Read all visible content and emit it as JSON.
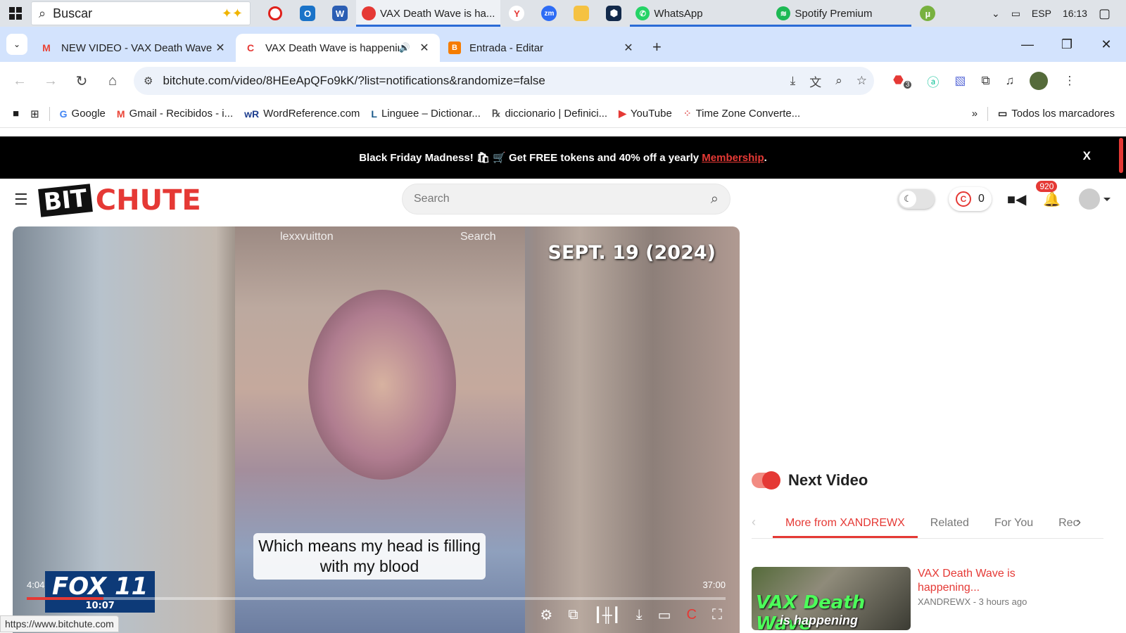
{
  "taskbar": {
    "search_text": "Buscar",
    "windows": [
      {
        "label": "VAX Death Wave is ha...",
        "active": true
      },
      {
        "label": "WhatsApp"
      },
      {
        "label": "Spotify Premium"
      }
    ],
    "lang": "ESP",
    "time": "16:13"
  },
  "tabs": [
    {
      "title": "NEW VIDEO - VAX Death Wave",
      "favicon": "gmail-icon"
    },
    {
      "title": "VAX Death Wave is happening",
      "favicon": "bitchute-icon",
      "active": true,
      "audio": true
    },
    {
      "title": "Entrada - Editar",
      "favicon": "blogger-icon"
    }
  ],
  "address": {
    "url": "bitchute.com/video/8HEeApQFo9kK/?list=notifications&randomize=false",
    "ext_badge": "3"
  },
  "bookmarks": {
    "items": [
      "Google",
      "Gmail - Recibidos - i...",
      "WordReference.com",
      "Linguee – Dictionar...",
      "diccionario | Definici...",
      "YouTube",
      "Time Zone Converte..."
    ],
    "all_label": "Todos los marcadores"
  },
  "banner": {
    "prefix": "Black Friday Madness! 🛍 🛒 Get ",
    "free": "FREE tokens",
    "mid": " and ",
    "pct": "40%",
    "suffix": " off a yearly ",
    "link": "Membership",
    "end": ".",
    "close": "X"
  },
  "header": {
    "logo_left": "BIT",
    "logo_right": "CHUTE",
    "search_placeholder": "Search",
    "coins": "0",
    "notifications": "920"
  },
  "video": {
    "date_overlay": "SEPT. 19 (2024)",
    "tt_search_user": "lexxvuitton",
    "tt_search_btn": "Search",
    "caption": "Which means my head is filling with my blood",
    "station": "FOX 11",
    "station_time": "10:07",
    "current_time": "4:04",
    "duration": "37:00",
    "progress": 0.11
  },
  "status_url": "https://www.bitchute.com",
  "sidebar": {
    "next_label": "Next Video",
    "tabs": [
      "More from XANDREWX",
      "Related",
      "For You",
      "Rec"
    ],
    "card": {
      "thumb_text": "VAX Death Wave",
      "thumb_text2": "is happening",
      "title": "VAX Death Wave is happening...",
      "meta": "XANDREWX - 3 hours ago"
    }
  }
}
